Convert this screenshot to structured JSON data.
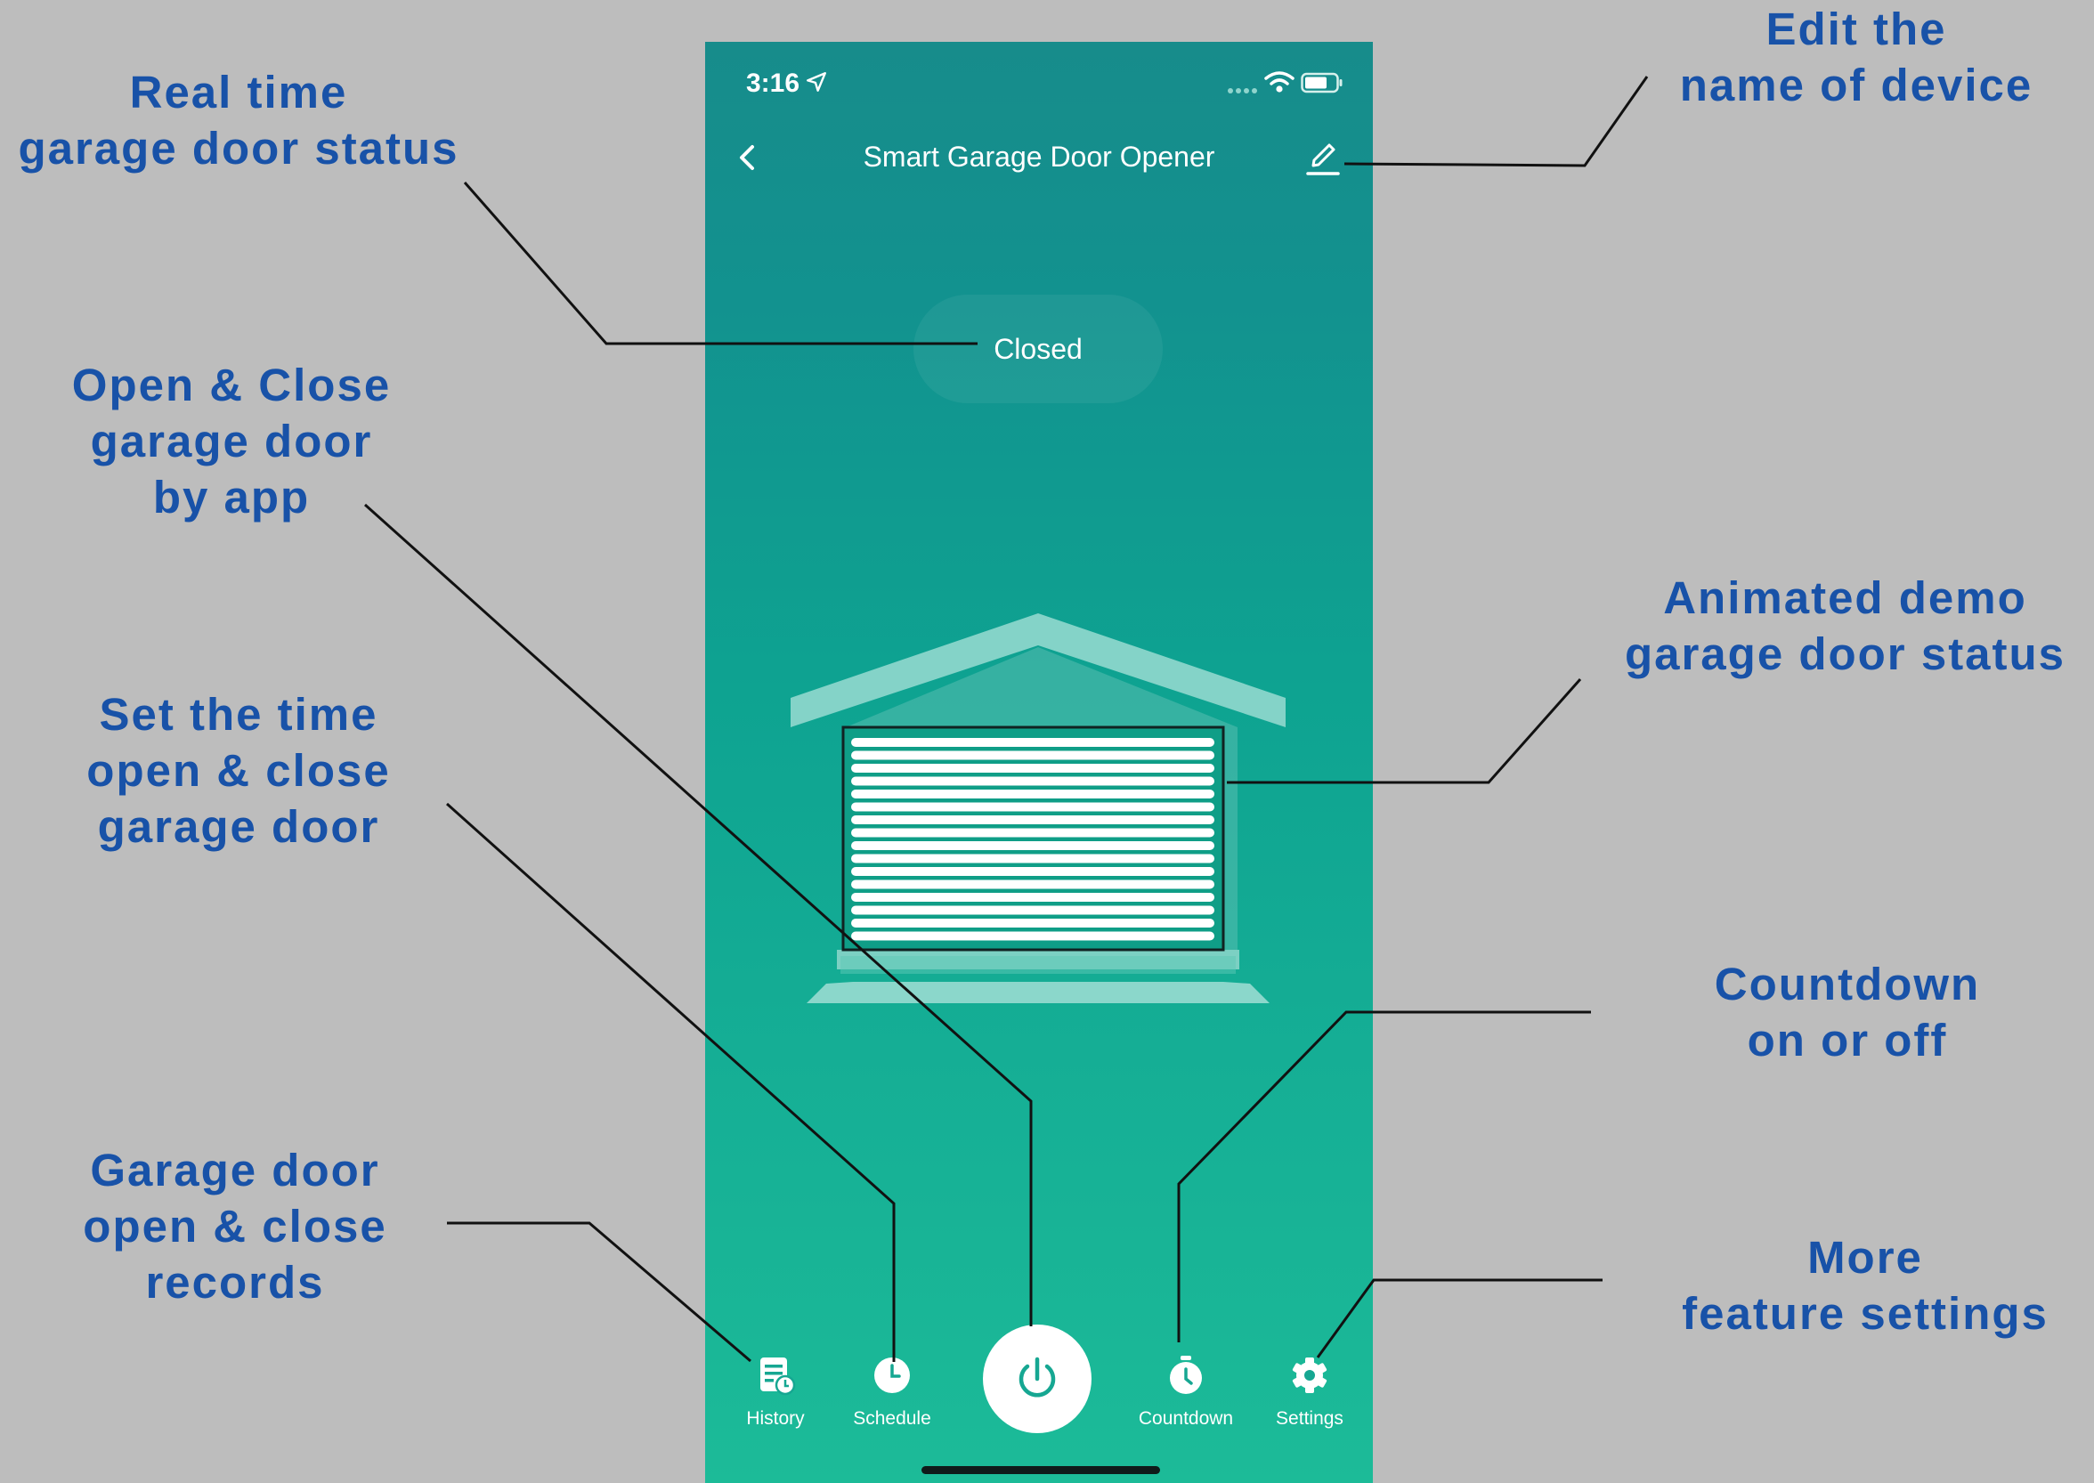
{
  "annotations": {
    "real_time_status": "Real time\ngarage door status",
    "open_close_by_app": "Open & Close\ngarage door\nby app",
    "set_time": "Set the time\nopen & close\ngarage door",
    "records": "Garage door\nopen & close\nrecords",
    "edit_name": "Edit the\nname of device",
    "animated_demo": "Animated demo\ngarage door status",
    "countdown": "Countdown\non or off",
    "more_settings": "More\nfeature settings"
  },
  "status_bar": {
    "time": "3:16",
    "icons": [
      "location-arrow-icon",
      "cellular-signal-icon",
      "wifi-icon",
      "battery-icon"
    ]
  },
  "header": {
    "title": "Smart Garage Door Opener",
    "back_icon": "chevron-left-icon",
    "edit_icon": "pencil-icon"
  },
  "door_status": "Closed",
  "tabs": [
    {
      "label": "History",
      "icon": "history-icon"
    },
    {
      "label": "Schedule",
      "icon": "clock-icon"
    },
    {
      "label": "Countdown",
      "icon": "timer-icon"
    },
    {
      "label": "Settings",
      "icon": "gear-icon"
    }
  ],
  "power_icon": "power-icon",
  "colors": {
    "annotation_text": "#1852a8",
    "background": "#bdbdbd",
    "app_teal_top": "#178c8b",
    "app_teal_bottom": "#1cbb98"
  }
}
